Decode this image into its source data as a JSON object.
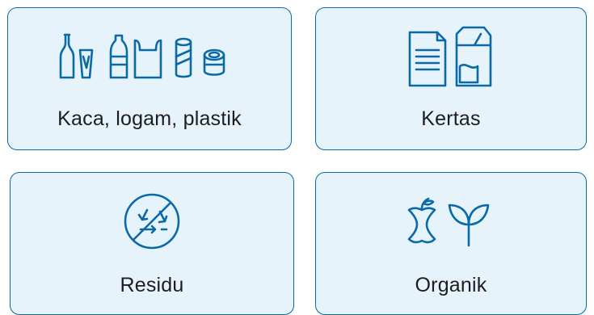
{
  "categories": [
    {
      "label": "Kaca, logam, plastik",
      "icons": [
        "glass-bottle-icon",
        "cup-icon",
        "plastic-bottle-icon",
        "plastic-bag-icon",
        "can-icon",
        "tin-can-icon"
      ]
    },
    {
      "label": "Kertas",
      "icons": [
        "paper-document-icon",
        "milk-carton-icon"
      ]
    },
    {
      "label": "Residu",
      "icons": [
        "no-recycle-icon"
      ]
    },
    {
      "label": "Organik",
      "icons": [
        "apple-core-icon",
        "sprout-icon"
      ]
    }
  ],
  "colors": {
    "accent": "#0a6aa6",
    "card_background": "#e7f3fb",
    "text": "#1d1d1d"
  }
}
